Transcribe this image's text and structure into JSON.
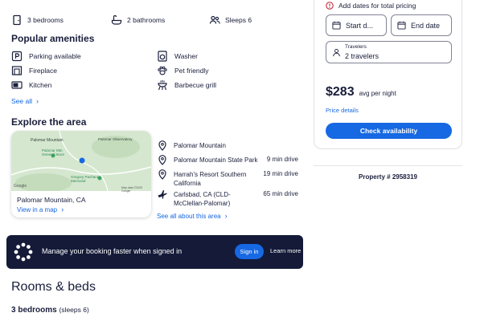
{
  "facts": {
    "bedrooms": "3 bedrooms",
    "bathrooms": "2 bathrooms",
    "sleeps": "Sleeps 6"
  },
  "amenities": {
    "title": "Popular amenities",
    "left": [
      "Parking available",
      "Fireplace",
      "Kitchen"
    ],
    "right": [
      "Washer",
      "Pet friendly",
      "Barbecue grill"
    ],
    "see_all": "See all"
  },
  "area": {
    "title": "Explore the area",
    "map_labels": {
      "palomar_mountain": "Palomar Mountain",
      "palomar_store": "Palomar Mtn General Store",
      "observatory": "Palomar Observatory",
      "gregory": "Gregory Pachanco Memorial",
      "google": "Google",
      "map_data": "Map data ©2025 Google"
    },
    "location": "Palomar Mountain, CA",
    "view_map": "View in a map",
    "places": [
      {
        "name": "Palomar Mountain",
        "distance": "",
        "icon": "pin-icon"
      },
      {
        "name": "Palomar Mountain State Park",
        "distance": "9 min drive",
        "icon": "pin-icon"
      },
      {
        "name": "Harrah's Resort Southern California",
        "distance": "19 min drive",
        "icon": "pin-icon"
      },
      {
        "name": "Carlsbad, CA (CLD-McClellan-Palomar)",
        "distance": "65 min drive",
        "icon": "airplane-icon"
      }
    ],
    "see_all": "See all about this area"
  },
  "banner": {
    "text": "Manage your booking faster when signed in",
    "signin": "Sign in",
    "learn_more": "Learn more"
  },
  "rooms": {
    "title": "Rooms & beds",
    "bedrooms": "3 bedrooms",
    "sleeps": "(sleeps 6)"
  },
  "booking": {
    "notice": "Add dates for total pricing",
    "start_date": "Start d...",
    "end_date": "End date",
    "travelers_label": "Travelers",
    "travelers_value": "2 travelers",
    "price": "$283",
    "price_unit": "avg per night",
    "price_details": "Price details",
    "check_button": "Check availability",
    "property_label": "Property #",
    "property_number": "2958319"
  },
  "colors": {
    "accent": "#1668e3",
    "banner_bg": "#141a38",
    "text": "#191e3b",
    "notice_red": "#c0182b"
  }
}
